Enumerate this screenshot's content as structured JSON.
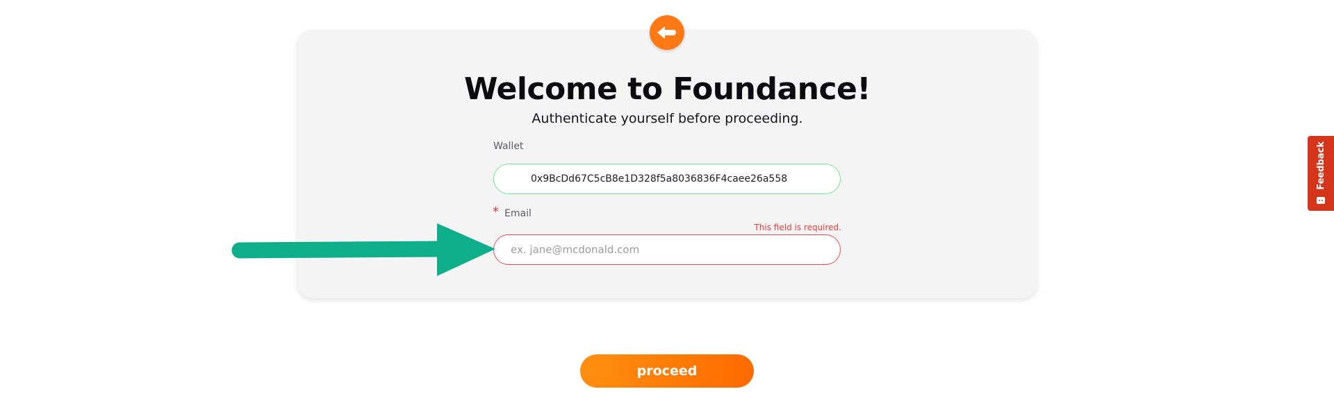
{
  "card": {
    "title": "Welcome to Foundance!",
    "subtitle": "Authenticate yourself before proceeding."
  },
  "wallet": {
    "label": "Wallet",
    "value": "0x9BcDd67C5cB8e1D328f5a8036836F4caee26a558"
  },
  "email": {
    "required_marker": "*",
    "label": "Email",
    "error": "This field is required.",
    "value": "",
    "placeholder": "ex. jane@mcdonald.com"
  },
  "actions": {
    "proceed_label": "proceed",
    "back_icon": "back-arrow-icon"
  },
  "feedback": {
    "label": "Feedback",
    "icon": "feedback-icon"
  },
  "annotation": {
    "arrow_color": "#0fae8b"
  },
  "colors": {
    "accent": "#ff7a14",
    "success_border": "#6ee291",
    "error": "#e23b3b",
    "feedback_bg": "#d5361b"
  }
}
